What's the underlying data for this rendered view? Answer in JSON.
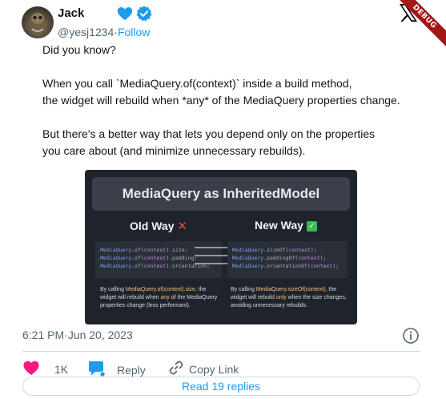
{
  "author": {
    "name": "Jack",
    "handle": "@yesj1234",
    "separator": "·",
    "follow_label": "Follow"
  },
  "debug_banner": "DEBUG",
  "tweet": {
    "lines": [
      "Did you know?",
      "",
      "When you call `MediaQuery.of(context)` inside a build method,",
      "the widget will rebuild when *any* of the MediaQuery properties change.",
      "",
      "But there's a better way that lets you depend only on the properties",
      "you care about (and minimize unnecessary rebuilds)."
    ]
  },
  "media": {
    "title": "MediaQuery as InheritedModel",
    "old_label": "Old Way",
    "new_label": "New Way",
    "old_code": [
      {
        "cls": "MediaQuery",
        "mid": ".of(",
        "ctx": "context",
        "end": ").size;"
      },
      {
        "cls": "MediaQuery",
        "mid": ".of(",
        "ctx": "context",
        "end": ").padding;"
      },
      {
        "cls": "MediaQuery",
        "mid": ".of(",
        "ctx": "context",
        "end": ").orientation;"
      }
    ],
    "new_code": [
      {
        "cls": "MediaQuery",
        "mid": ".sizeOf(",
        "ctx": "context",
        "end": ");"
      },
      {
        "cls": "MediaQuery",
        "mid": ".paddingOf(",
        "ctx": "context",
        "end": ");"
      },
      {
        "cls": "MediaQuery",
        "mid": ".orientationOf(",
        "ctx": "context",
        "end": ");"
      }
    ],
    "old_caption": {
      "a": "By calling ",
      "hl1": "MediaQuery.of(context).size",
      "b": ", the widget will rebuild when ",
      "hl2": "any",
      "c": " of the MediaQuery properties change (less performant)."
    },
    "new_caption": {
      "a": "By calling ",
      "hl1": "MediaQuery.sizeOf(context)",
      "b": ", the widget will rebuild ",
      "hl2": "only",
      "c": " when the size changes, avoiding unnecessary rebuilds."
    }
  },
  "meta": {
    "time": "6:21 PM",
    "separator": "·",
    "date": "Jun 20, 2023"
  },
  "actions": {
    "like_count": "1K",
    "reply_label": "Reply",
    "copy_label": "Copy Link",
    "read_replies_label": "Read 19 replies"
  },
  "colors": {
    "accent": "#1d9bf0",
    "like": "#f91880",
    "secondary_text": "#536471"
  }
}
